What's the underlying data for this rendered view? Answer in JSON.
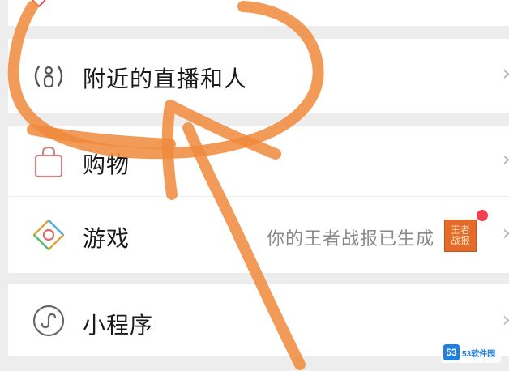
{
  "menu": {
    "items": [
      {
        "label": "附近的直播和人",
        "icon": "nearby-live-icon"
      },
      {
        "label": "购物",
        "icon": "shopping-bag-icon"
      },
      {
        "label": "游戏",
        "icon": "game-icon",
        "subtitle": "你的王者战报已生成",
        "thumbnail_text": "王者战报",
        "has_badge": true
      },
      {
        "label": "小程序",
        "icon": "mini-program-icon"
      }
    ],
    "chevron": "›"
  },
  "watermark": {
    "text": "53软件园",
    "logo_text": "53"
  },
  "colors": {
    "annotation": "#f08a3c",
    "badge": "#f5404f",
    "background": "#ededed"
  }
}
